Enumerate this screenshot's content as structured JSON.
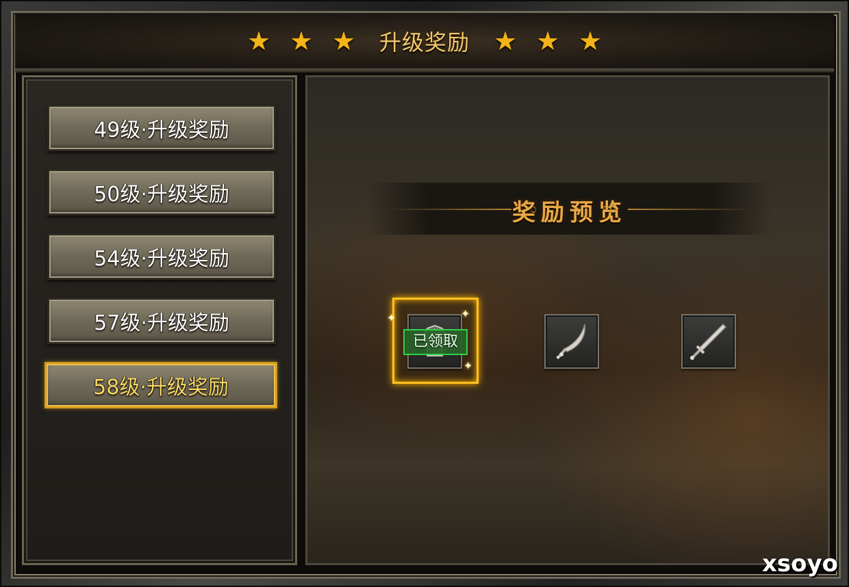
{
  "header": {
    "title": "升级奖励",
    "stars_left": [
      "★",
      "★",
      "★"
    ],
    "stars_right": [
      "★",
      "★",
      "★"
    ],
    "star_color": "#f2b418"
  },
  "level_list": {
    "items": [
      {
        "label": "49级·升级奖励",
        "selected": false
      },
      {
        "label": "50级·升级奖励",
        "selected": false
      },
      {
        "label": "54级·升级奖励",
        "selected": false
      },
      {
        "label": "57级·升级奖励",
        "selected": false
      },
      {
        "label": "58级·升级奖励",
        "selected": true
      }
    ]
  },
  "preview": {
    "title": "奖励预览",
    "swirl_left": "ಌ",
    "swirl_right": "ಌ",
    "items": [
      {
        "icon": "armor-icon",
        "claimed": true,
        "claimed_label": "已领取"
      },
      {
        "icon": "curved-blade-icon",
        "claimed": false
      },
      {
        "icon": "sword-icon",
        "claimed": false
      }
    ],
    "highlight_color": "#ffc21f"
  },
  "watermark": "xsoyo"
}
